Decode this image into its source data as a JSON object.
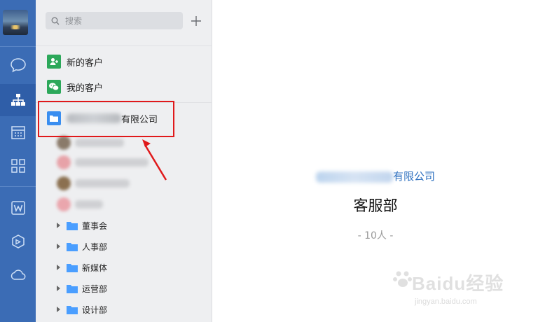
{
  "colors": {
    "rail": "#3b6cb5",
    "accent": "#2c6fbf",
    "highlight": "#e0191b",
    "folder": "#4a9eff"
  },
  "rail": {
    "items": [
      {
        "icon": "chat-bubble-icon"
      },
      {
        "icon": "org-chart-icon",
        "active": true
      },
      {
        "icon": "calendar-icon"
      },
      {
        "icon": "grid-apps-icon"
      },
      {
        "icon": "w-document-icon"
      },
      {
        "icon": "cube-icon"
      },
      {
        "icon": "cloud-icon"
      }
    ]
  },
  "search": {
    "placeholder": "搜索"
  },
  "contacts": {
    "new_customers": "新的客户",
    "my_customers": "我的客户",
    "company_suffix": "有限公司",
    "departments": [
      "董事会",
      "人事部",
      "新媒体",
      "运营部",
      "设计部"
    ]
  },
  "detail": {
    "company_suffix": "有限公司",
    "department": "客服部",
    "member_count": "- 10人 -"
  },
  "watermark": {
    "main": "Baidu经验",
    "sub": "jingyan.baidu.com"
  }
}
